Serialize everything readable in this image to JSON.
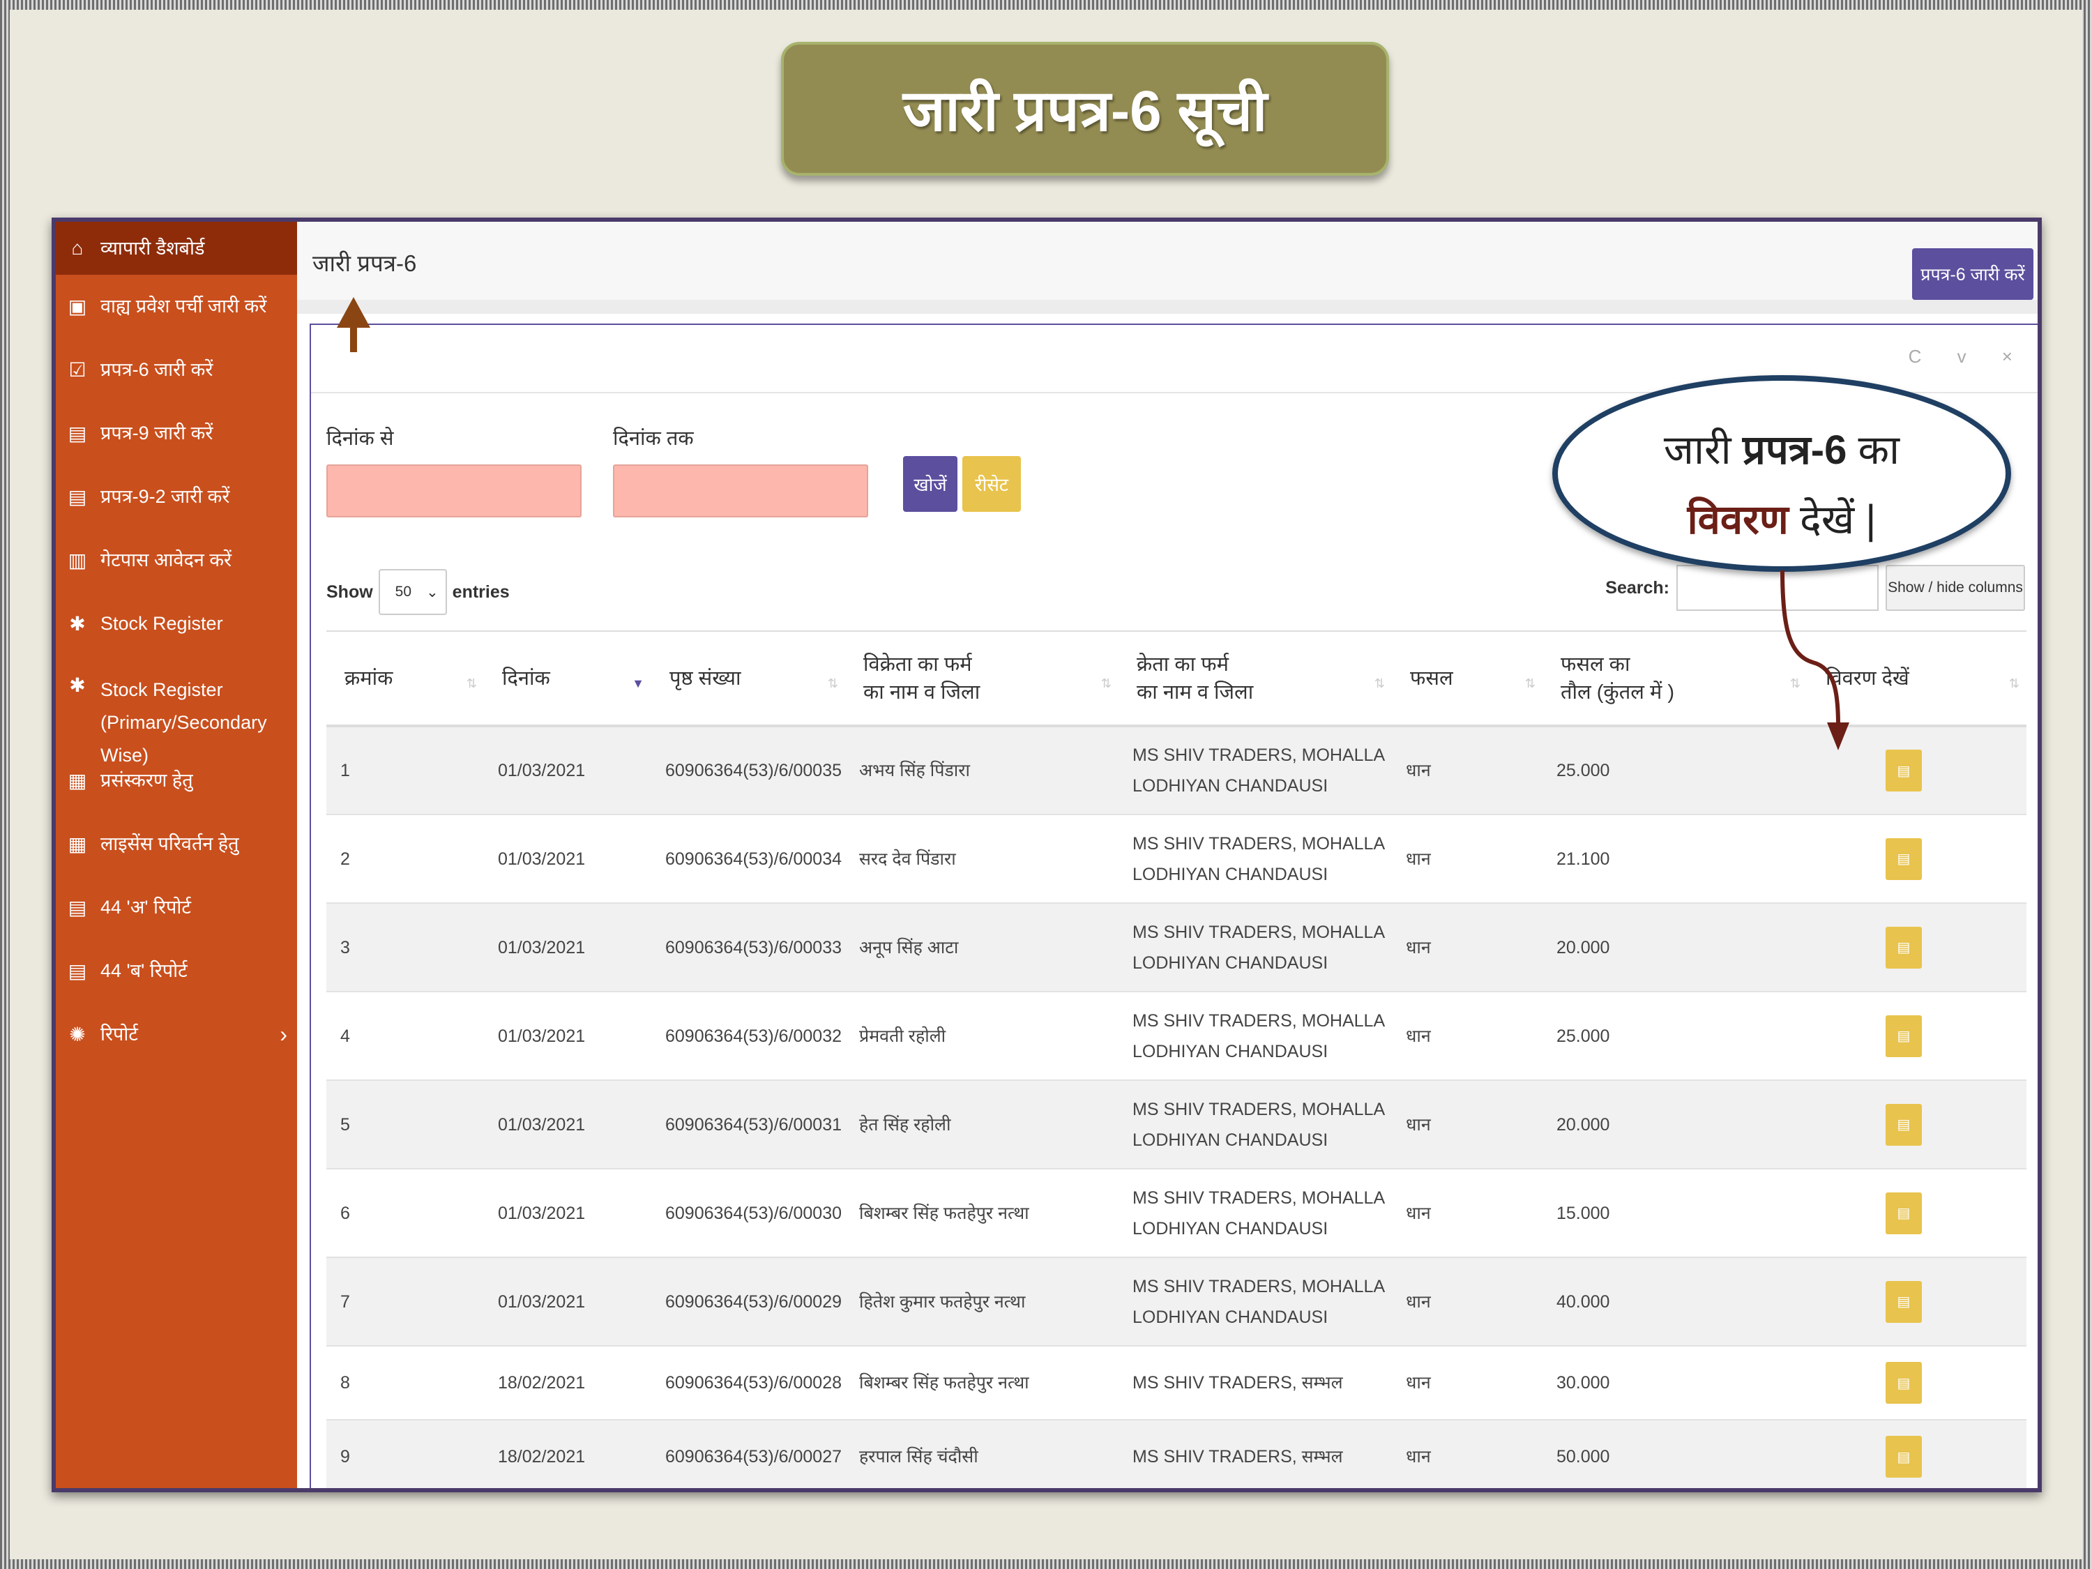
{
  "slide": {
    "title": "जारी प्रपत्र-6 सूची"
  },
  "sidebar": {
    "items": [
      {
        "label": "व्यापारी डैशबोर्ड",
        "icon": "home-icon"
      },
      {
        "label": "वाह्य प्रवेश पर्ची जारी करें",
        "icon": "document-scan-icon"
      },
      {
        "label": "प्रपत्र-6 जारी करें",
        "icon": "checkbox-icon"
      },
      {
        "label": "प्रपत्र-9 जारी करें",
        "icon": "file-icon"
      },
      {
        "label": "प्रपत्र-9-2 जारी करें",
        "icon": "file-icon"
      },
      {
        "label": "गेटपास आवेदन करें",
        "icon": "bar-chart-icon"
      },
      {
        "label": "Stock Register",
        "icon": "snowflake-icon"
      },
      {
        "label": "Stock Register (Primary/Secondary Wise)",
        "icon": "snowflake-icon"
      },
      {
        "label": "प्रसंस्करण हेतु",
        "icon": "grid-icon"
      },
      {
        "label": "लाइसेंस परिवर्तन हेतु",
        "icon": "grid-icon"
      },
      {
        "label": "44 'अ' रिपोर्ट",
        "icon": "file-icon"
      },
      {
        "label": "44 'ब' रिपोर्ट",
        "icon": "file-icon"
      },
      {
        "label": "रिपोर्ट",
        "icon": "gear-icon",
        "chevron": "›"
      }
    ]
  },
  "topbar": {
    "page_name": "जारी प्रपत्र-6",
    "issue_button": "प्रपत्र-6 जारी करें"
  },
  "panel": {
    "tools": "C v ×"
  },
  "filters": {
    "from_label": "दिनांक से",
    "to_label": "दिनांक तक",
    "from_value": "",
    "to_value": "",
    "search_button": "खोजें",
    "reset_button": "रीसेट"
  },
  "table_controls": {
    "show_label": "Show",
    "page_size": "50",
    "entries_label": "entries",
    "search_label": "Search:",
    "search_value": "",
    "columns_button": "Show / hide columns"
  },
  "table": {
    "headers": [
      [
        "क्रमांक"
      ],
      [
        "दिनांक"
      ],
      [
        "पृष्ठ संख्या"
      ],
      [
        "विक्रेता का फर्म",
        "का नाम व जिला"
      ],
      [
        "क्रेता का फर्म",
        "का नाम व जिला"
      ],
      [
        "फसल"
      ],
      [
        "फसल का",
        "तौल (कुंतल में )"
      ],
      [
        "विवरण देखें"
      ]
    ],
    "rows": [
      {
        "sno": "1",
        "date": "01/03/2021",
        "page": "60906364(53)/6/00035",
        "seller": "अभय सिंह पिंडारा",
        "buyer": [
          "MS SHIV TRADERS, MOHALLA",
          "LODHIYAN CHANDAUSI"
        ],
        "crop": "धान",
        "weight": "25.000"
      },
      {
        "sno": "2",
        "date": "01/03/2021",
        "page": "60906364(53)/6/00034",
        "seller": "सरद देव पिंडारा",
        "buyer": [
          "MS SHIV TRADERS, MOHALLA",
          "LODHIYAN CHANDAUSI"
        ],
        "crop": "धान",
        "weight": "21.100"
      },
      {
        "sno": "3",
        "date": "01/03/2021",
        "page": "60906364(53)/6/00033",
        "seller": "अनूप सिंह आटा",
        "buyer": [
          "MS SHIV TRADERS, MOHALLA",
          "LODHIYAN CHANDAUSI"
        ],
        "crop": "धान",
        "weight": "20.000"
      },
      {
        "sno": "4",
        "date": "01/03/2021",
        "page": "60906364(53)/6/00032",
        "seller": "प्रेमवती रहोली",
        "buyer": [
          "MS SHIV TRADERS, MOHALLA",
          "LODHIYAN CHANDAUSI"
        ],
        "crop": "धान",
        "weight": "25.000"
      },
      {
        "sno": "5",
        "date": "01/03/2021",
        "page": "60906364(53)/6/00031",
        "seller": "हेत सिंह रहोली",
        "buyer": [
          "MS SHIV TRADERS, MOHALLA",
          "LODHIYAN CHANDAUSI"
        ],
        "crop": "धान",
        "weight": "20.000"
      },
      {
        "sno": "6",
        "date": "01/03/2021",
        "page": "60906364(53)/6/00030",
        "seller": "बिशम्बर सिंह फतहेपुर नत्था",
        "buyer": [
          "MS SHIV TRADERS, MOHALLA",
          "LODHIYAN CHANDAUSI"
        ],
        "crop": "धान",
        "weight": "15.000"
      },
      {
        "sno": "7",
        "date": "01/03/2021",
        "page": "60906364(53)/6/00029",
        "seller": "हितेश कुमार फतहेपुर नत्था",
        "buyer": [
          "MS SHIV TRADERS, MOHALLA",
          "LODHIYAN CHANDAUSI"
        ],
        "crop": "धान",
        "weight": "40.000"
      },
      {
        "sno": "8",
        "date": "18/02/2021",
        "page": "60906364(53)/6/00028",
        "seller": "बिशम्बर सिंह फतहेपुर नत्था",
        "buyer": [
          "MS SHIV TRADERS, सम्भल"
        ],
        "crop": "धान",
        "weight": "30.000"
      },
      {
        "sno": "9",
        "date": "18/02/2021",
        "page": "60906364(53)/6/00027",
        "seller": "हरपाल सिंह चंदौसी",
        "buyer": [
          "MS SHIV TRADERS, सम्भल"
        ],
        "crop": "धान",
        "weight": "50.000"
      }
    ],
    "action_icon": "pdf-icon"
  },
  "callout": {
    "line1_a": "जारी",
    "line1_b": "प्रपत्र-6",
    "line1_c": "का",
    "line2_a": "विवरण",
    "line2_b": "देखें |"
  },
  "colors": {
    "sidebar": "#c94f1d",
    "sidebar_active": "#8e2c0a",
    "primary": "#5b4f9e",
    "warning": "#e8c34d",
    "date_input": "#fdb7ad",
    "title_box": "#938c52",
    "arrow": "#8b4513",
    "callout_arrow": "#6b1f16"
  }
}
